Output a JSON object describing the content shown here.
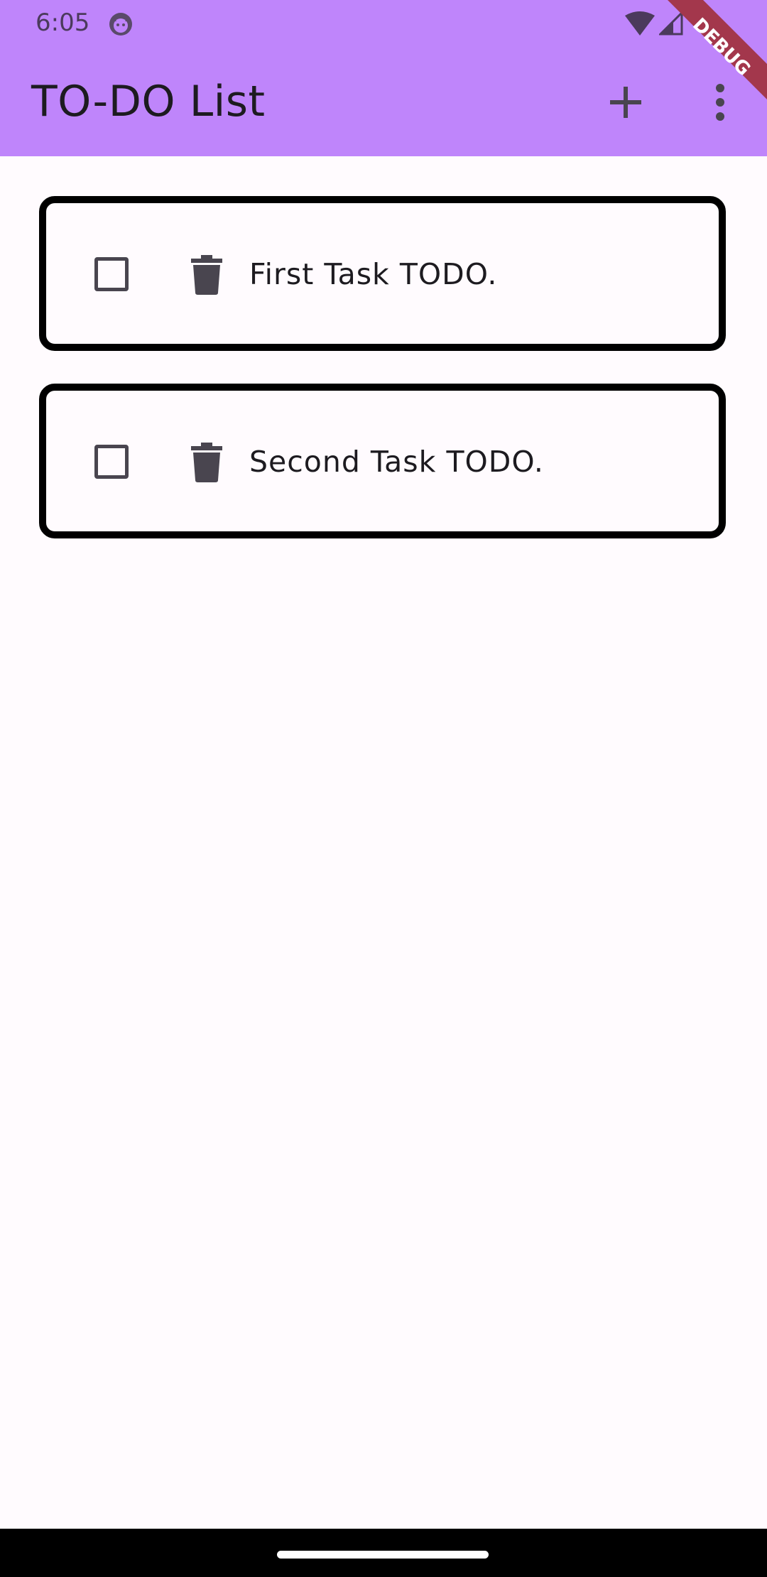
{
  "status_bar": {
    "time": "6:05",
    "icons": [
      "app-notification-icon",
      "wifi-icon",
      "signal-icon"
    ]
  },
  "app_bar": {
    "title": "TO-DO List",
    "actions": [
      "add-icon",
      "more-vert-icon"
    ],
    "color": "#bf85fb"
  },
  "debug_banner": {
    "label": "DEBUG",
    "color": "#a3374c"
  },
  "tasks": [
    {
      "label": "First Task TODO.",
      "checked": false
    },
    {
      "label": "Second Task TODO.",
      "checked": false
    }
  ]
}
